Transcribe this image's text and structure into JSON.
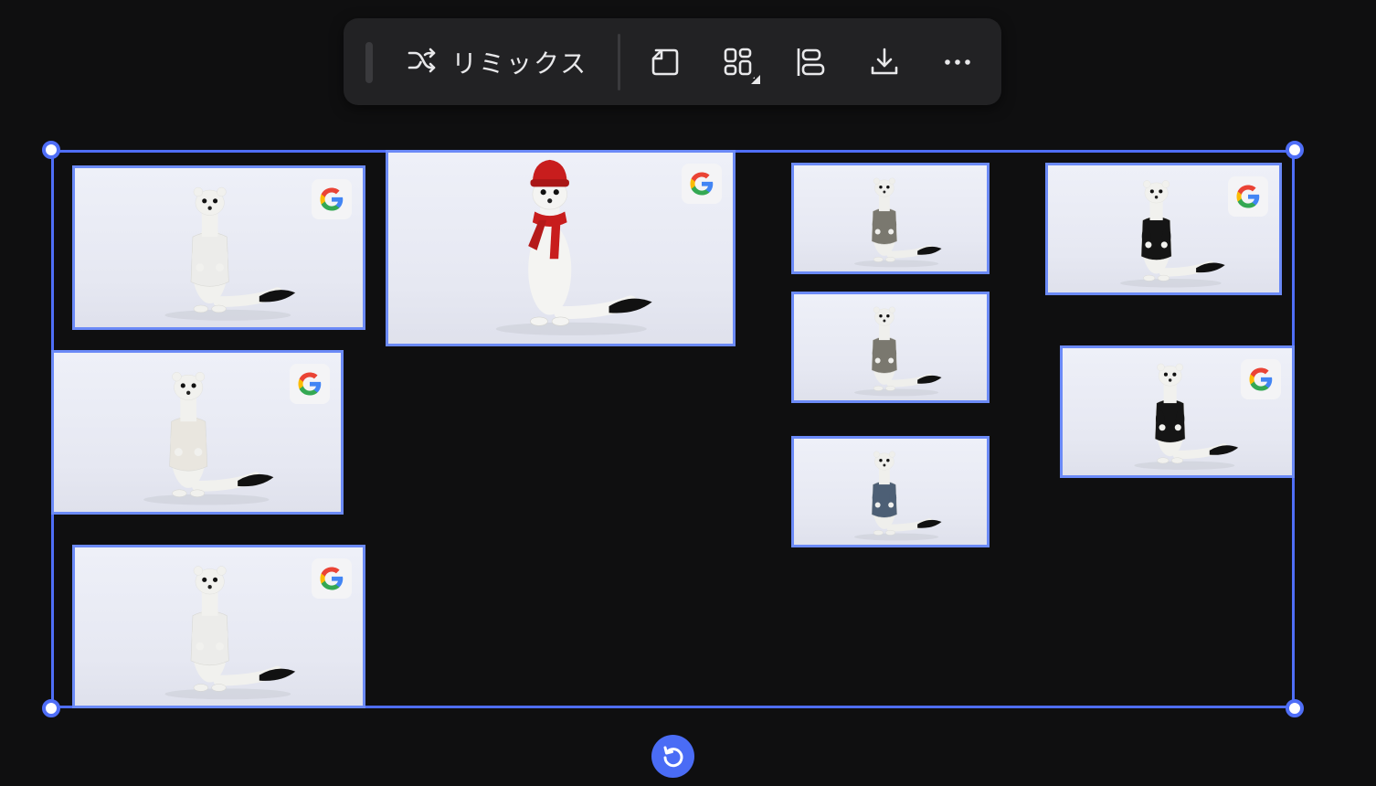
{
  "toolbar": {
    "remix_label": "リミックス",
    "buttons": [
      {
        "name": "aspect-ratio-icon"
      },
      {
        "name": "layout-grid-icon"
      },
      {
        "name": "align-left-icon"
      },
      {
        "name": "download-icon"
      },
      {
        "name": "more-options-icon"
      }
    ]
  },
  "canvas": {
    "selection_color": "#4f6ef7",
    "card_border_color": "#6b8af7",
    "images": [
      {
        "outfit": "white-sweater",
        "badge": "google-icon"
      },
      {
        "outfit": "red-hat-and-scarf",
        "badge": "google-icon"
      },
      {
        "outfit": "grey-hoodie",
        "badge": "none"
      },
      {
        "outfit": "black-sweater",
        "badge": "google-icon"
      },
      {
        "outfit": "cream-cable-sweater",
        "badge": "google-icon"
      },
      {
        "outfit": "grey-hoodie",
        "badge": "none"
      },
      {
        "outfit": "black-sweater",
        "badge": "google-icon"
      },
      {
        "outfit": "denim-overalls",
        "badge": "none"
      },
      {
        "outfit": "white-sweater",
        "badge": "google-icon"
      }
    ]
  }
}
